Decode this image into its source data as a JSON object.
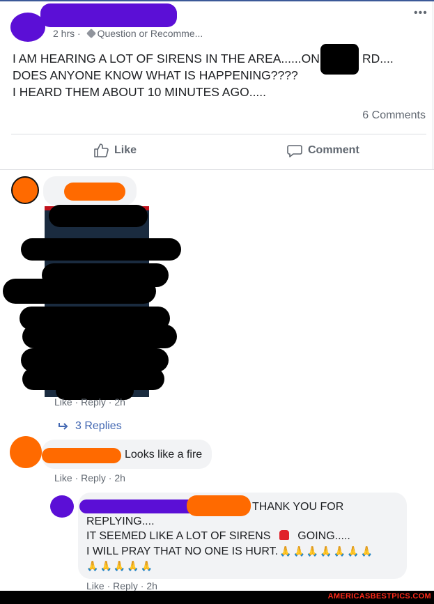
{
  "post": {
    "meta_time": "2 hrs",
    "meta_separator": "·",
    "meta_category": "Question or Recomme...",
    "more_label": "•••",
    "lines": [
      "I AM HEARING A LOT OF SIRENS IN THE AREA......ON ",
      "DOES ANYONE KNOW WHAT IS HAPPENING????",
      "I HEARD THEM ABOUT 10 MINUTES AGO....."
    ],
    "rd_suffix": "RD....",
    "comments_count": "6 Comments",
    "like_label": "Like",
    "comment_label": "Comment"
  },
  "comment1": {
    "actions": "Like · Reply · 2h",
    "replies_label": "3 Replies"
  },
  "comment2": {
    "text": "Looks like a fire",
    "actions": "Like · Reply · 2h"
  },
  "reply": {
    "line1": "THANK YOU FOR",
    "line2": "REPLYING....",
    "line3a": "IT SEEMED LIKE A LOT OF SIRENS",
    "line3b": "GOING.....",
    "line4": "I WILL PRAY THAT NO ONE IS HURT.",
    "actions": "Like · Reply · 2h",
    "pray_emoji": "🙏"
  },
  "watermark": "AMERICASBESTPICS.COM",
  "colors": {
    "redact_purple": "#5b0fd6",
    "redact_orange": "#ff6a00",
    "link_blue": "#4267b2"
  }
}
